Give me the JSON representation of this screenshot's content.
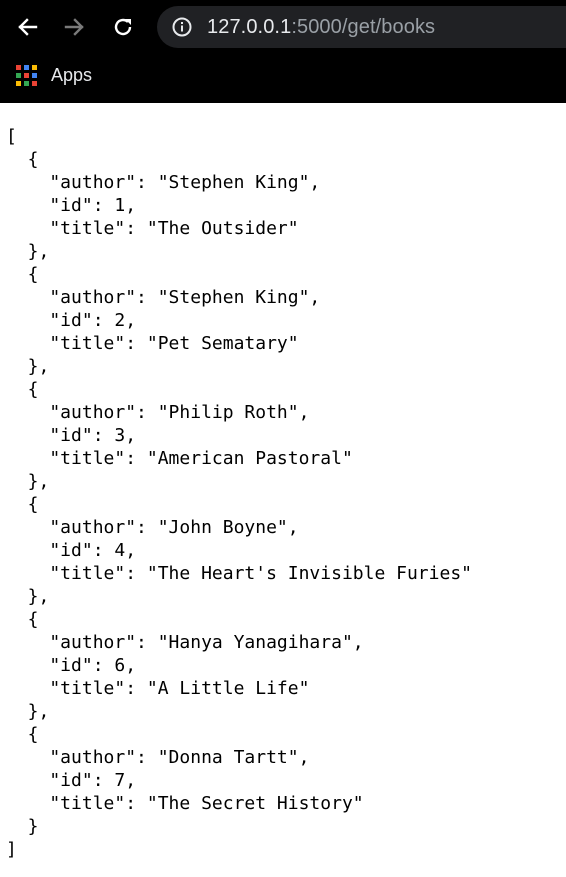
{
  "browser": {
    "url_host": "127.0.0.1",
    "url_path": ":5000/get/books",
    "bookmarks": {
      "apps_label": "Apps",
      "apps_colors": [
        "#ea4335",
        "#4285f4",
        "#fbbc05",
        "#34a853",
        "#ea4335",
        "#4285f4",
        "#fbbc05",
        "#34a853",
        "#ea4335"
      ]
    },
    "icons": [
      "back-arrow-icon",
      "forward-arrow-icon",
      "reload-icon",
      "info-icon",
      "apps-grid-icon"
    ]
  },
  "json_lines": [
    "[",
    "  {",
    "    \"author\": \"Stephen King\",",
    "    \"id\": 1,",
    "    \"title\": \"The Outsider\"",
    "  },",
    "  {",
    "    \"author\": \"Stephen King\",",
    "    \"id\": 2,",
    "    \"title\": \"Pet Sematary\"",
    "  },",
    "  {",
    "    \"author\": \"Philip Roth\",",
    "    \"id\": 3,",
    "    \"title\": \"American Pastoral\"",
    "  },",
    "  {",
    "    \"author\": \"John Boyne\",",
    "    \"id\": 4,",
    "    \"title\": \"The Heart's Invisible Furies\"",
    "  },",
    "  {",
    "    \"author\": \"Hanya Yanagihara\",",
    "    \"id\": 6,",
    "    \"title\": \"A Little Life\"",
    "  },",
    "  {",
    "    \"author\": \"Donna Tartt\",",
    "    \"id\": 7,",
    "    \"title\": \"The Secret History\"",
    "  }",
    "]"
  ]
}
